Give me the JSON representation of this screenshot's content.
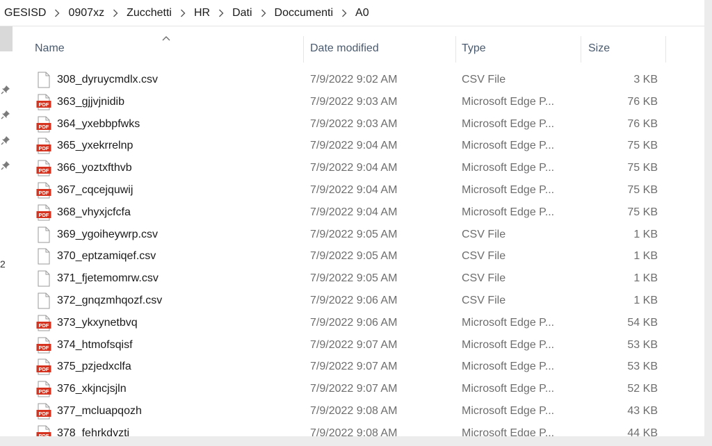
{
  "breadcrumb": [
    "GESISD",
    "0907xz",
    "Zucchetti",
    "HR",
    "Dati",
    "Doccumenti",
    "A0"
  ],
  "nav": {
    "partial_label": "2"
  },
  "columns": {
    "name": "Name",
    "date": "Date modified",
    "type": "Type",
    "size": "Size"
  },
  "icons": {
    "pdf": "pdf-file-icon",
    "csv": "csv-file-icon",
    "pin": "pin-icon",
    "sort": "sort-ascending-icon",
    "separator": "chevron-right-icon"
  },
  "colors": {
    "pdf_red": "#d5331f",
    "header_text": "#4a5a6e"
  },
  "files": [
    {
      "name": "308_dyruycmdlx.csv",
      "date": "7/9/2022 9:02 AM",
      "type": "CSV File",
      "size": "3 KB",
      "kind": "csv"
    },
    {
      "name": "363_gjjvjnidib",
      "date": "7/9/2022 9:03 AM",
      "type": "Microsoft Edge P...",
      "size": "76 KB",
      "kind": "pdf"
    },
    {
      "name": "364_yxebbpfwks",
      "date": "7/9/2022 9:03 AM",
      "type": "Microsoft Edge P...",
      "size": "76 KB",
      "kind": "pdf"
    },
    {
      "name": "365_yxekrrelnp",
      "date": "7/9/2022 9:04 AM",
      "type": "Microsoft Edge P...",
      "size": "75 KB",
      "kind": "pdf"
    },
    {
      "name": "366_yoztxfthvb",
      "date": "7/9/2022 9:04 AM",
      "type": "Microsoft Edge P...",
      "size": "75 KB",
      "kind": "pdf"
    },
    {
      "name": "367_cqcejquwij",
      "date": "7/9/2022 9:04 AM",
      "type": "Microsoft Edge P...",
      "size": "75 KB",
      "kind": "pdf"
    },
    {
      "name": "368_vhyxjcfcfa",
      "date": "7/9/2022 9:04 AM",
      "type": "Microsoft Edge P...",
      "size": "75 KB",
      "kind": "pdf"
    },
    {
      "name": "369_ygoiheywrp.csv",
      "date": "7/9/2022 9:05 AM",
      "type": "CSV File",
      "size": "1 KB",
      "kind": "csv"
    },
    {
      "name": "370_eptzamiqef.csv",
      "date": "7/9/2022 9:05 AM",
      "type": "CSV File",
      "size": "1 KB",
      "kind": "csv"
    },
    {
      "name": "371_fjetemomrw.csv",
      "date": "7/9/2022 9:05 AM",
      "type": "CSV File",
      "size": "1 KB",
      "kind": "csv"
    },
    {
      "name": "372_gnqzmhqozf.csv",
      "date": "7/9/2022 9:06 AM",
      "type": "CSV File",
      "size": "1 KB",
      "kind": "csv"
    },
    {
      "name": "373_ykxynetbvq",
      "date": "7/9/2022 9:06 AM",
      "type": "Microsoft Edge P...",
      "size": "54 KB",
      "kind": "pdf"
    },
    {
      "name": "374_htmofsqisf",
      "date": "7/9/2022 9:07 AM",
      "type": "Microsoft Edge P...",
      "size": "53 KB",
      "kind": "pdf"
    },
    {
      "name": "375_pzjedxclfa",
      "date": "7/9/2022 9:07 AM",
      "type": "Microsoft Edge P...",
      "size": "53 KB",
      "kind": "pdf"
    },
    {
      "name": "376_xkjncjsjln",
      "date": "7/9/2022 9:07 AM",
      "type": "Microsoft Edge P...",
      "size": "52 KB",
      "kind": "pdf"
    },
    {
      "name": "377_mcluapqozh",
      "date": "7/9/2022 9:08 AM",
      "type": "Microsoft Edge P...",
      "size": "43 KB",
      "kind": "pdf"
    },
    {
      "name": "378_fehrkdyzti",
      "date": "7/9/2022 9:08 AM",
      "type": "Microsoft Edge P...",
      "size": "44 KB",
      "kind": "pdf"
    }
  ]
}
